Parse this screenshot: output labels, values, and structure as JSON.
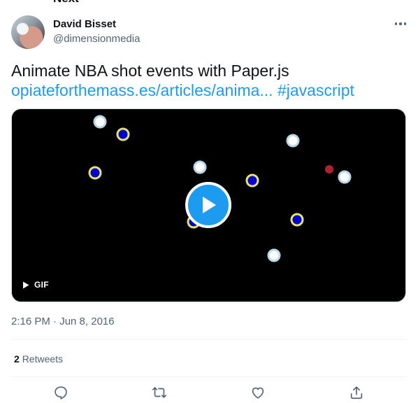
{
  "top_cut_text": "Next",
  "author": {
    "display_name": "David Bisset",
    "handle": "@dimensionmedia",
    "avatar": "user-avatar-photo"
  },
  "more_icon": "more-horizontal-icon",
  "tweet": {
    "text": "Animate NBA shot events with Paper.js",
    "link": "opiateforthemass.es/articles/anima...",
    "hashtag": "#javascript"
  },
  "media": {
    "type": "GIF",
    "badge_label": "GIF",
    "play_icon": "play-icon",
    "background": "#000000",
    "player_color": "#1d9bf0",
    "shot_markers": [
      {
        "kind": "white"
      },
      {
        "kind": "blue"
      },
      {
        "kind": "blue"
      },
      {
        "kind": "white"
      },
      {
        "kind": "white"
      },
      {
        "kind": "blue"
      },
      {
        "kind": "red"
      },
      {
        "kind": "white"
      },
      {
        "kind": "blue"
      },
      {
        "kind": "blue"
      },
      {
        "kind": "white"
      }
    ]
  },
  "timestamp": "2:16 PM · Jun 8, 2016",
  "stats": {
    "retweet_count": "2",
    "retweet_label": "Retweets"
  },
  "actions": {
    "reply_icon": "reply-icon",
    "retweet_icon": "retweet-icon",
    "like_icon": "heart-icon",
    "share_icon": "share-icon"
  },
  "colors": {
    "accent": "#1d9bf0",
    "text_primary": "#0f1419",
    "text_secondary": "#536471",
    "shot_made_fill": "#0000cc",
    "shot_made_ring": "#e8e36a",
    "shot_white": "#ffffff",
    "shot_red": "#b02030"
  }
}
